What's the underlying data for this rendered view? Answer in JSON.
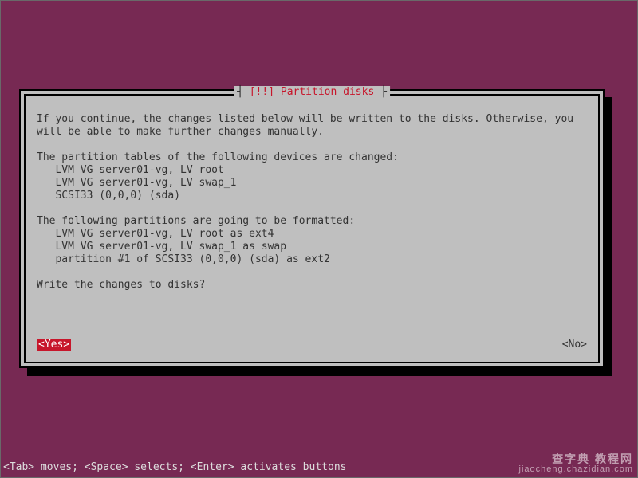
{
  "dialog": {
    "title_prefix": "┤",
    "title_mark": " [!!] ",
    "title_text": "Partition disks",
    "title_suffix": " ├",
    "intro": "If you continue, the changes listed below will be written to the disks. Otherwise, you will be able to make further changes manually.",
    "changed_heading": "The partition tables of the following devices are changed:",
    "changed_items": [
      "LVM VG server01-vg, LV root",
      "LVM VG server01-vg, LV swap_1",
      "SCSI33 (0,0,0) (sda)"
    ],
    "format_heading": "The following partitions are going to be formatted:",
    "format_items": [
      "LVM VG server01-vg, LV root as ext4",
      "LVM VG server01-vg, LV swap_1 as swap",
      "partition #1 of SCSI33 (0,0,0) (sda) as ext2"
    ],
    "question": "Write the changes to disks?",
    "yes_label": "<Yes>",
    "no_label": "<No>"
  },
  "help_bar": "<Tab> moves; <Space> selects; <Enter> activates buttons",
  "watermark": {
    "line1": "查字典  教程网",
    "line2": "jiaocheng.chazidian.com"
  }
}
